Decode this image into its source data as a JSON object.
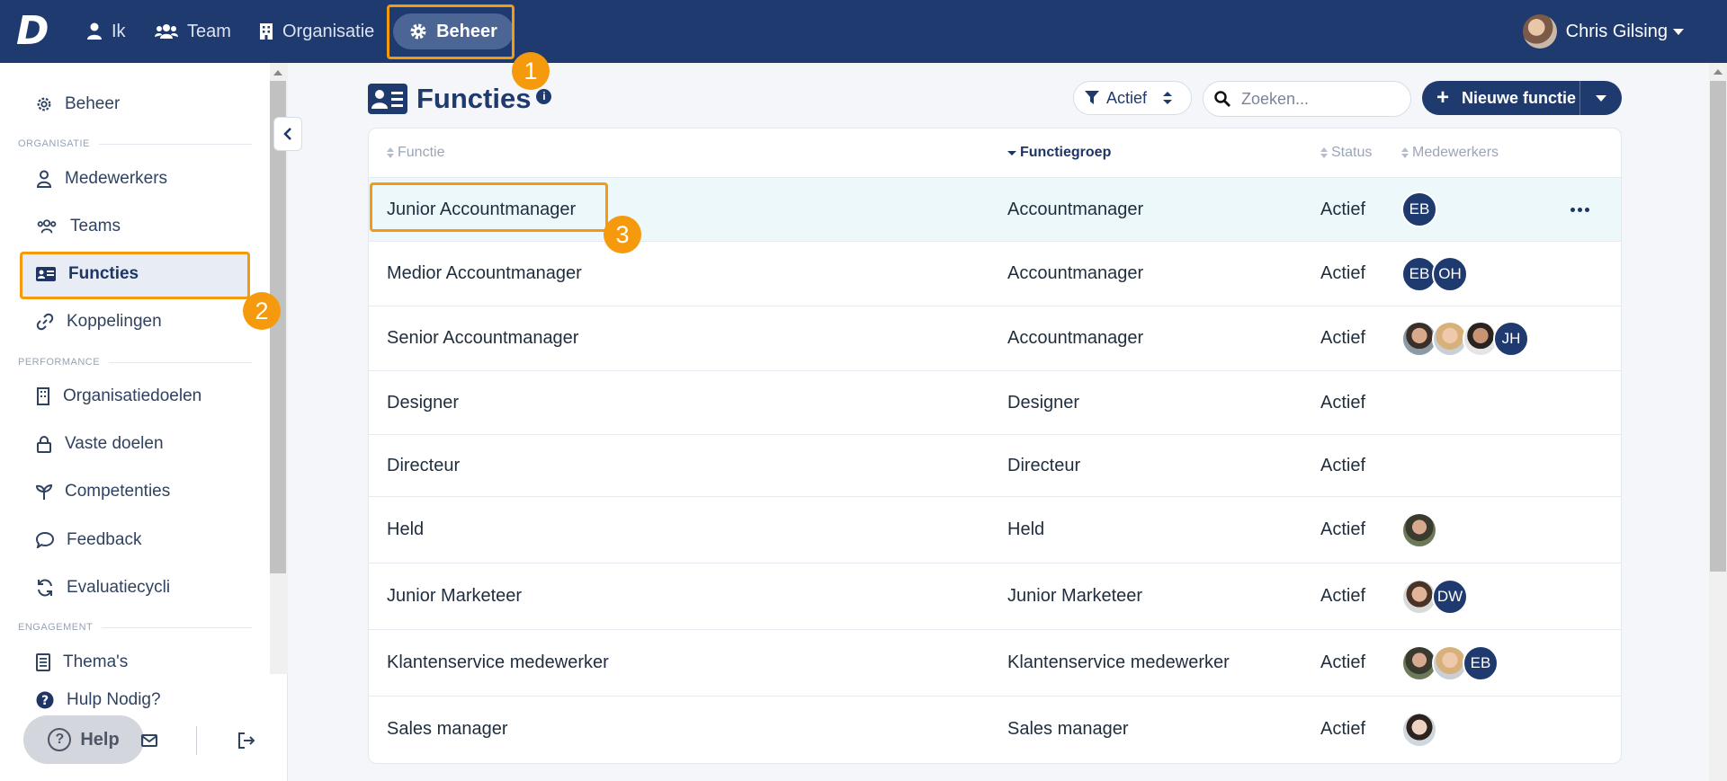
{
  "topbar": {
    "logo": "D",
    "nav": [
      {
        "label": "Ik",
        "icon": "user-icon"
      },
      {
        "label": "Team",
        "icon": "users-icon"
      },
      {
        "label": "Organisatie",
        "icon": "building-icon"
      },
      {
        "label": "Beheer",
        "icon": "gear-icon",
        "active": true
      }
    ],
    "user_name": "Chris Gilsing"
  },
  "sidebar": {
    "top_item": "Beheer",
    "sections": [
      {
        "title": "ORGANISATIE",
        "items": [
          "Medewerkers",
          "Teams",
          "Functies",
          "Koppelingen"
        ]
      },
      {
        "title": "PERFORMANCE",
        "items": [
          "Organisatiedoelen",
          "Vaste doelen",
          "Competenties",
          "Feedback",
          "Evaluatiecycli"
        ]
      },
      {
        "title": "ENGAGEMENT",
        "items": [
          "Thema's"
        ]
      }
    ],
    "active_item": "Functies",
    "help_link": "Hulp Nodig?",
    "help_button": "Help"
  },
  "main": {
    "title": "Functies",
    "filter_label": "Actief",
    "search_placeholder": "Zoeken...",
    "new_button": "Nieuwe functie",
    "columns": [
      "Functie",
      "Functiegroep",
      "Status",
      "Medewerkers"
    ],
    "rows": [
      {
        "functie": "Junior Accountmanager",
        "groep": "Accountmanager",
        "status": "Actief",
        "medewerkers": [
          "EB"
        ]
      },
      {
        "functie": "Medior Accountmanager",
        "groep": "Accountmanager",
        "status": "Actief",
        "medewerkers": [
          "EB",
          "OH"
        ]
      },
      {
        "functie": "Senior Accountmanager",
        "groep": "Accountmanager",
        "status": "Actief",
        "medewerkers": [
          "photo",
          "photo",
          "photo",
          "JH"
        ]
      },
      {
        "functie": "Designer",
        "groep": "Designer",
        "status": "Actief",
        "medewerkers": []
      },
      {
        "functie": "Directeur",
        "groep": "Directeur",
        "status": "Actief",
        "medewerkers": []
      },
      {
        "functie": "Held",
        "groep": "Held",
        "status": "Actief",
        "medewerkers": [
          "photo"
        ]
      },
      {
        "functie": "Junior Marketeer",
        "groep": "Junior Marketeer",
        "status": "Actief",
        "medewerkers": [
          "photo",
          "DW"
        ]
      },
      {
        "functie": "Klantenservice medewerker",
        "groep": "Klantenservice medewerker",
        "status": "Actief",
        "medewerkers": [
          "photo",
          "photo",
          "EB"
        ]
      },
      {
        "functie": "Sales manager",
        "groep": "Sales manager",
        "status": "Actief",
        "medewerkers": [
          "photo"
        ]
      }
    ]
  },
  "annotations": {
    "step1": "1",
    "step2": "2",
    "step3": "3"
  },
  "colors": {
    "primary": "#1e3a6e",
    "accent": "#f59a0c",
    "highlight_row": "#edf8fb"
  }
}
